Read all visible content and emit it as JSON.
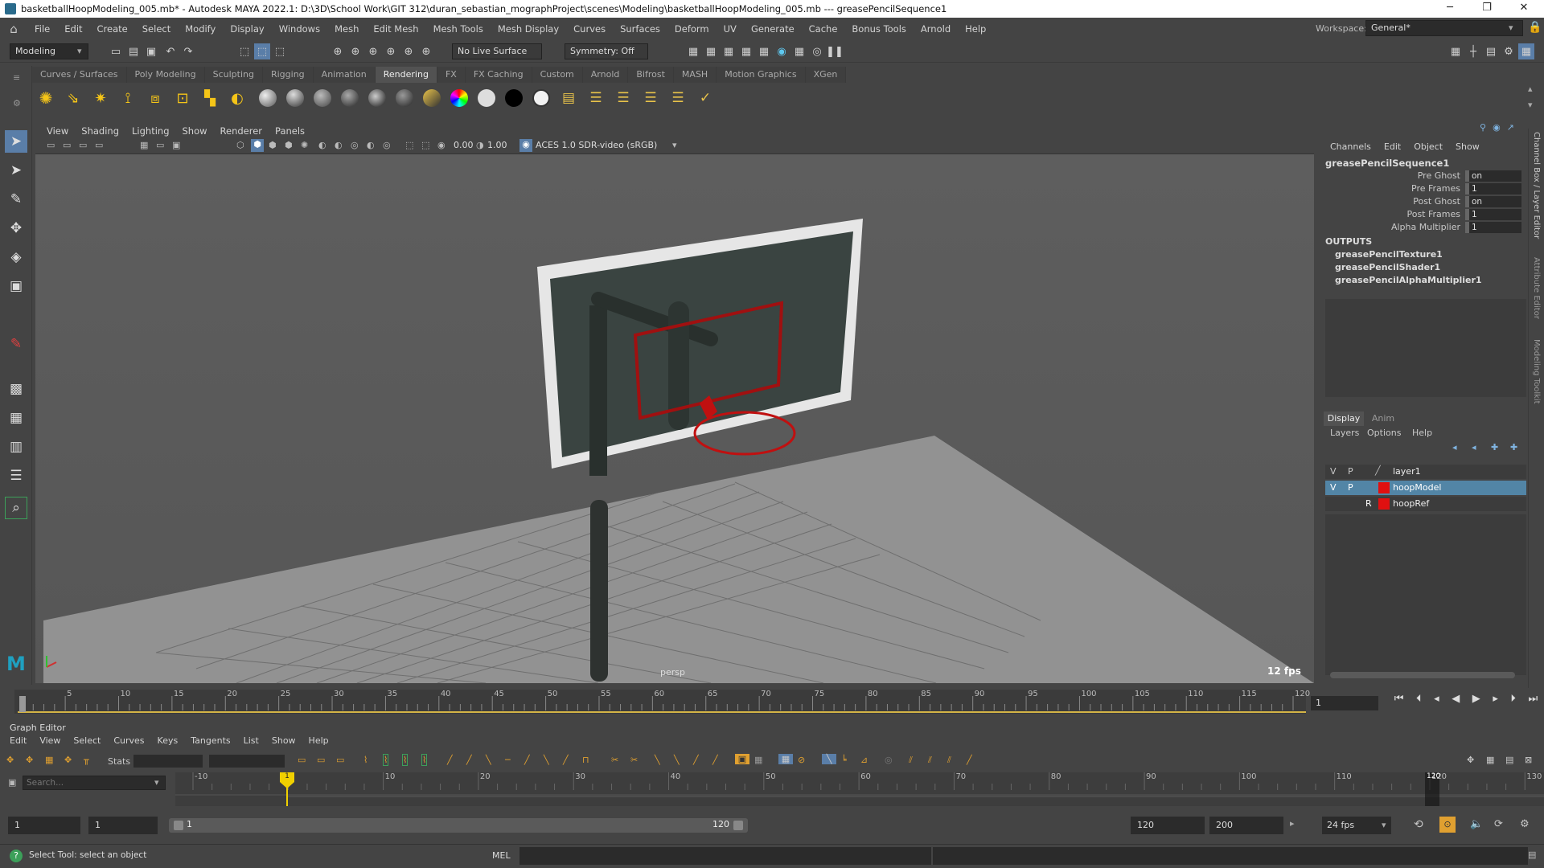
{
  "window": {
    "title": "basketballHoopModeling_005.mb* - Autodesk MAYA 2022.1: D:\\3D\\School Work\\GIT 312\\duran_sebastian_mographProject\\scenes\\Modeling\\basketballHoopModeling_005.mb  ---  greasePencilSequence1",
    "minimize": "─",
    "maximize": "❐",
    "close": "✕"
  },
  "menubar": {
    "items": [
      "File",
      "Edit",
      "Create",
      "Select",
      "Modify",
      "Display",
      "Windows",
      "Mesh",
      "Edit Mesh",
      "Mesh Tools",
      "Mesh Display",
      "Curves",
      "Surfaces",
      "Deform",
      "UV",
      "Generate",
      "Cache",
      "Bonus Tools",
      "Arnold",
      "Help"
    ],
    "workspace_label": "Workspace:",
    "workspace_value": "General*"
  },
  "statusline": {
    "mode": "Modeling",
    "live_surface": "No Live Surface",
    "symmetry": "Symmetry: Off"
  },
  "shelf": {
    "tabs": [
      "Curves / Surfaces",
      "Poly Modeling",
      "Sculpting",
      "Rigging",
      "Animation",
      "Rendering",
      "FX",
      "FX Caching",
      "Custom",
      "Arnold",
      "Bifrost",
      "MASH",
      "Motion Graphics",
      "XGen"
    ],
    "active_tab": "Rendering"
  },
  "viewport": {
    "menus": [
      "View",
      "Shading",
      "Lighting",
      "Show",
      "Renderer",
      "Panels"
    ],
    "exposure": "0.00",
    "gamma": "1.00",
    "color_space": "ACES 1.0 SDR-video (sRGB)",
    "camera_label": "persp",
    "fps": "12 fps"
  },
  "channelbox": {
    "menus": [
      "Channels",
      "Edit",
      "Object",
      "Show"
    ],
    "node_name": "greasePencilSequence1",
    "attributes": [
      {
        "label": "Pre Ghost",
        "value": "on"
      },
      {
        "label": "Pre Frames",
        "value": "1"
      },
      {
        "label": "Post Ghost",
        "value": "on"
      },
      {
        "label": "Post Frames",
        "value": "1"
      },
      {
        "label": "Alpha Multiplier",
        "value": "1"
      }
    ],
    "outputs_label": "OUTPUTS",
    "outputs": [
      "greasePencilTexture1",
      "greasePencilShader1",
      "greasePencilAlphaMultiplier1"
    ]
  },
  "side_tabs": [
    "Channel Box / Layer Editor",
    "Attribute Editor",
    "Modeling Toolkit"
  ],
  "layer_editor": {
    "tabs": [
      "Display",
      "Anim"
    ],
    "active_tab": "Display",
    "menus": [
      "Layers",
      "Options",
      "Help"
    ],
    "layers": [
      {
        "v": "V",
        "p": "P",
        "r": "",
        "name": "layer1",
        "color": "",
        "selected": false
      },
      {
        "v": "V",
        "p": "P",
        "r": "",
        "name": "hoopModel",
        "color": "#e01010",
        "selected": true
      },
      {
        "v": "",
        "p": "",
        "r": "R",
        "name": "hoopRef",
        "color": "#e01010",
        "selected": false
      }
    ]
  },
  "timeslider": {
    "ticks": [
      "5",
      "10",
      "15",
      "20",
      "25",
      "30",
      "35",
      "40",
      "45",
      "50",
      "55",
      "60",
      "65",
      "70",
      "75",
      "80",
      "85",
      "90",
      "95",
      "100",
      "105",
      "110",
      "115",
      "120"
    ],
    "current_frame": "1"
  },
  "graph_editor": {
    "title": "Graph Editor",
    "menus": [
      "Edit",
      "View",
      "Select",
      "Curves",
      "Keys",
      "Tangents",
      "List",
      "Show",
      "Help"
    ],
    "stats_label": "Stats",
    "search_placeholder": "Search...",
    "ruler": [
      "-10",
      "10",
      "20",
      "30",
      "40",
      "50",
      "60",
      "70",
      "80",
      "90",
      "100",
      "110",
      "120",
      "130"
    ],
    "playhead": "1",
    "end_marker": "120"
  },
  "range": {
    "start": "1",
    "playback_start": "1",
    "slider_start": "1",
    "slider_end": "120",
    "playback_end": "120",
    "end": "200",
    "fps": "24 fps"
  },
  "commandline": {
    "help_text": "Select Tool: select an object",
    "language": "MEL"
  }
}
